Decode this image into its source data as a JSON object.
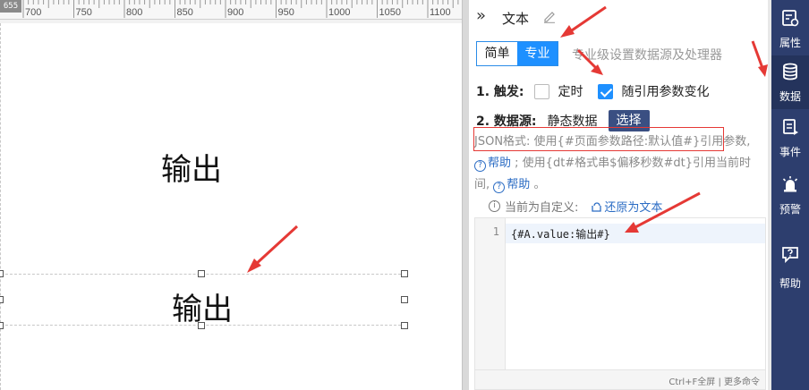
{
  "ruler": {
    "corner_value": "655",
    "labels": [
      "700",
      "750",
      "800",
      "850",
      "900",
      "950",
      "1000",
      "1050",
      "1100"
    ]
  },
  "canvas": {
    "text_1": "输出",
    "text_2": "输出"
  },
  "panel": {
    "title": "文本",
    "tabs": {
      "simple": "简单",
      "pro": "专业"
    },
    "mode_desc": "专业级设置数据源及处理器",
    "trigger": {
      "label": "1. 触发:",
      "timed": "定时",
      "timed_checked": false,
      "follow": "随引用参数变化",
      "follow_checked": true
    },
    "datasource": {
      "label": "2. 数据源:",
      "value": "静态数据",
      "select_button": "选择"
    },
    "json_hint": {
      "part1": "JSON格式:  使用{#页面参数路径:默认值#}引用参数,",
      "help1": "帮助",
      "part2": "; 使用{dt#格式串$偏移秒数#dt}引用当前时间,",
      "help2": "帮助",
      "part3": "。"
    },
    "custom_note": "当前为自定义:",
    "restore_link": "还原为文本",
    "editor": {
      "line_number": "1",
      "code": "{#A.value:输出#}",
      "footer_hint": "Ctrl+F全屏 | 更多命令"
    }
  },
  "right_nav": [
    {
      "label": "属性",
      "icon": "properties-icon"
    },
    {
      "label": "数据",
      "icon": "database-icon",
      "active": true
    },
    {
      "label": "事件",
      "icon": "event-icon"
    },
    {
      "label": "预警",
      "icon": "alarm-icon"
    },
    {
      "label": "帮助",
      "icon": "help-icon"
    }
  ],
  "colors": {
    "accent": "#1e90ff",
    "nav_bg": "#2d3e6e",
    "annotation_red": "#e53935",
    "select_button_bg": "#3a4f82"
  }
}
